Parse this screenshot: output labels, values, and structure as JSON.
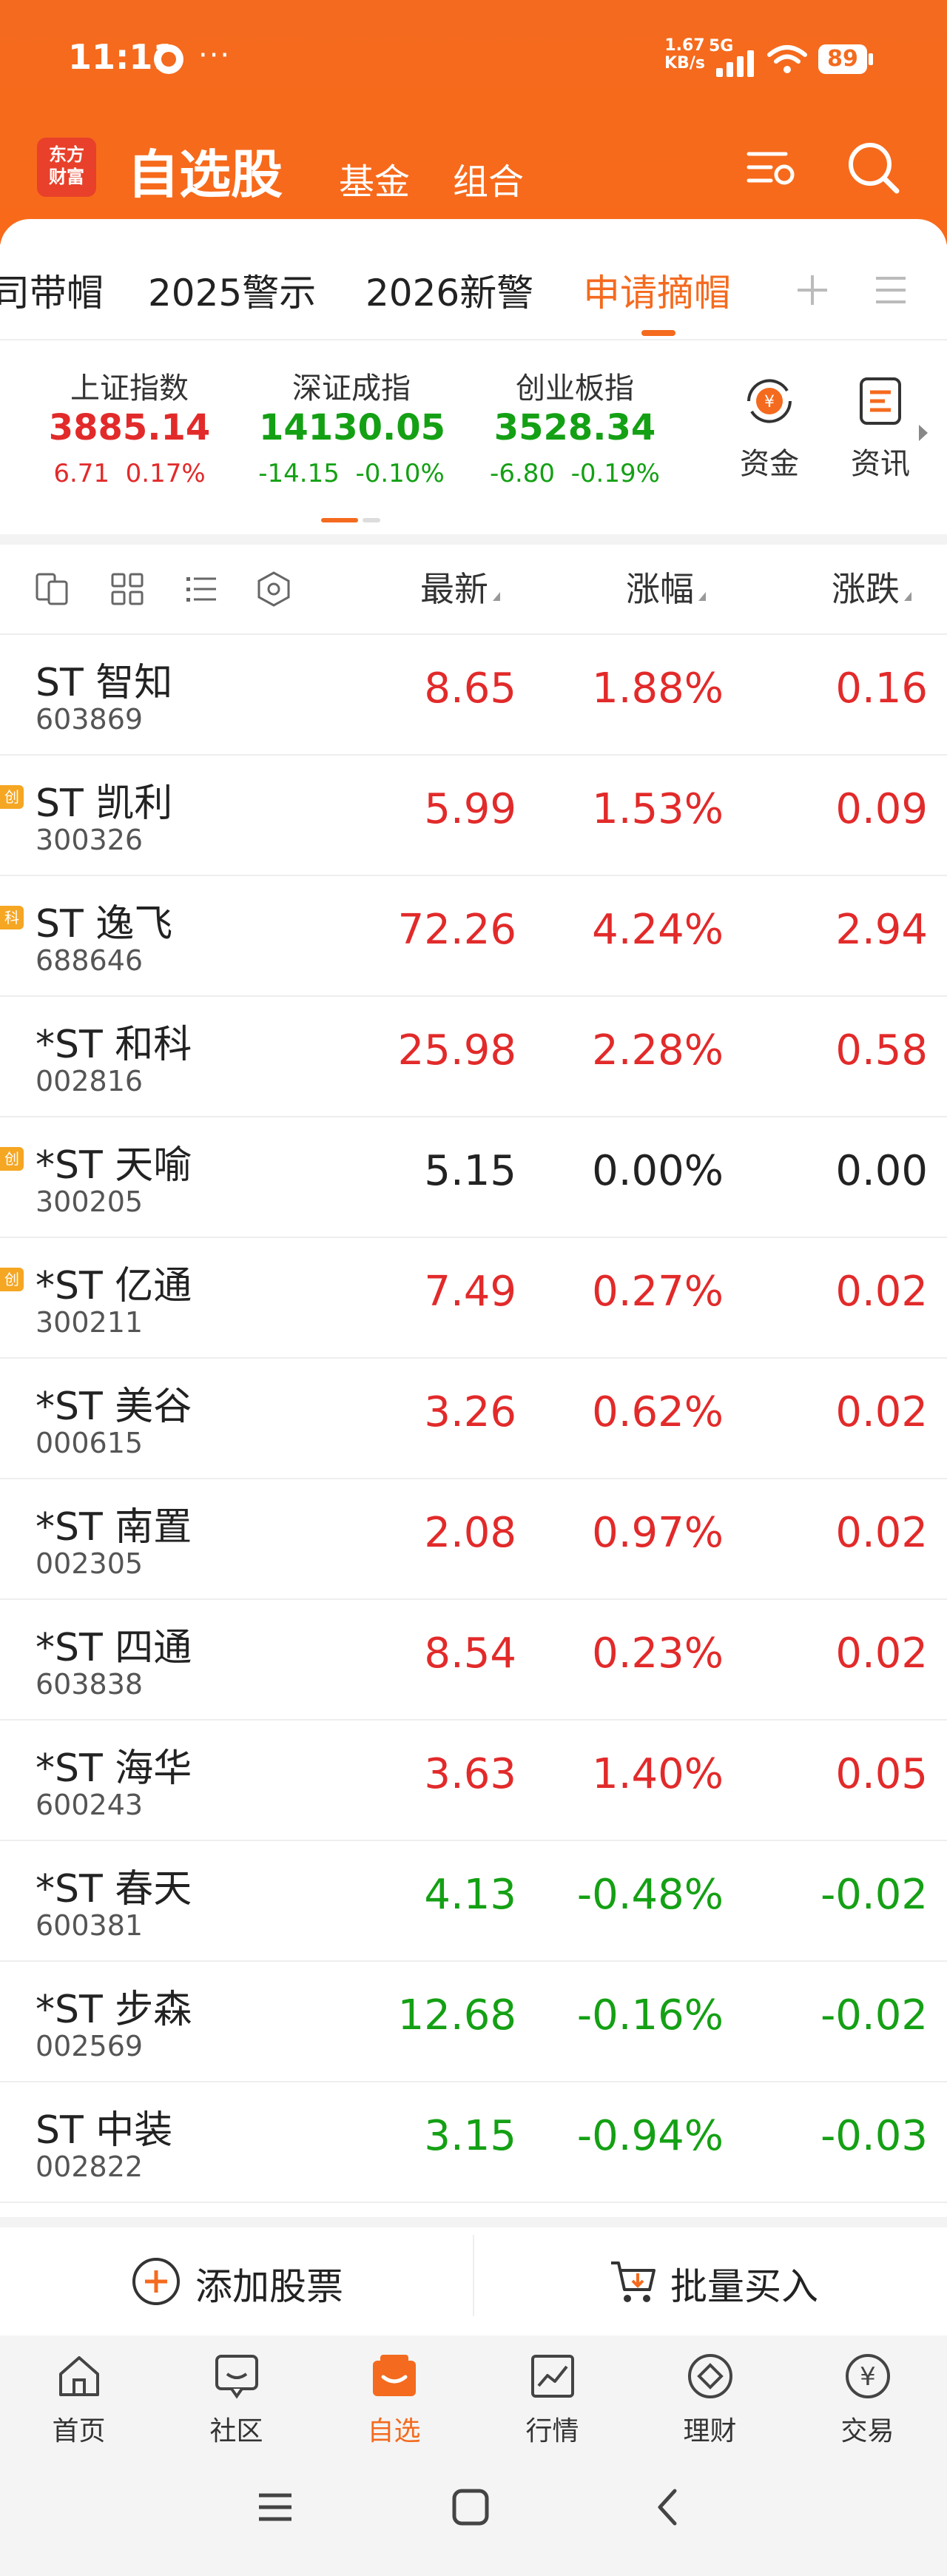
{
  "status_bar": {
    "time": "11:11",
    "more": "···",
    "net_speed_value": "1.67",
    "net_speed_unit": "KB/s",
    "network": "5G",
    "battery": "89"
  },
  "header": {
    "logo_line1": "东方",
    "logo_line2": "财富",
    "title": "自选股",
    "tabs": [
      "基金",
      "组合"
    ],
    "icons": [
      "settings-filter-icon",
      "search-icon"
    ]
  },
  "watchlist_tabs": {
    "items": [
      "司带帽",
      "2025警示",
      "2026新警",
      "申请摘帽"
    ],
    "active_index": 3
  },
  "indices": [
    {
      "name": "上证指数",
      "value": "3885.14",
      "change": "6.71",
      "pct": "0.17%",
      "direction": "up"
    },
    {
      "name": "深证成指",
      "value": "14130.05",
      "change": "-14.15",
      "pct": "-0.10%",
      "direction": "down"
    },
    {
      "name": "创业板指",
      "value": "3528.34",
      "change": "-6.80",
      "pct": "-0.19%",
      "direction": "down"
    }
  ],
  "side_buttons": [
    {
      "label": "资金",
      "icon": "yuan-flow-icon"
    },
    {
      "label": "资讯",
      "icon": "news-doc-icon"
    }
  ],
  "columns": {
    "price": "最新",
    "pct": "涨幅",
    "change": "涨跌"
  },
  "stocks": [
    {
      "name": "ST 智知",
      "code": "603869",
      "tag": "",
      "price": "8.65",
      "pct": "1.88%",
      "change": "0.16",
      "direction": "up"
    },
    {
      "name": "ST 凯利",
      "code": "300326",
      "tag": "创",
      "price": "5.99",
      "pct": "1.53%",
      "change": "0.09",
      "direction": "up"
    },
    {
      "name": "ST 逸飞",
      "code": "688646",
      "tag": "科",
      "price": "72.26",
      "pct": "4.24%",
      "change": "2.94",
      "direction": "up"
    },
    {
      "name": "*ST 和科",
      "code": "002816",
      "tag": "",
      "price": "25.98",
      "pct": "2.28%",
      "change": "0.58",
      "direction": "up"
    },
    {
      "name": "*ST 天喻",
      "code": "300205",
      "tag": "创",
      "price": "5.15",
      "pct": "0.00%",
      "change": "0.00",
      "direction": "flat"
    },
    {
      "name": "*ST 亿通",
      "code": "300211",
      "tag": "创",
      "price": "7.49",
      "pct": "0.27%",
      "change": "0.02",
      "direction": "up"
    },
    {
      "name": "*ST 美谷",
      "code": "000615",
      "tag": "",
      "price": "3.26",
      "pct": "0.62%",
      "change": "0.02",
      "direction": "up"
    },
    {
      "name": "*ST 南置",
      "code": "002305",
      "tag": "",
      "price": "2.08",
      "pct": "0.97%",
      "change": "0.02",
      "direction": "up"
    },
    {
      "name": "*ST 四通",
      "code": "603838",
      "tag": "",
      "price": "8.54",
      "pct": "0.23%",
      "change": "0.02",
      "direction": "up"
    },
    {
      "name": "*ST 海华",
      "code": "600243",
      "tag": "",
      "price": "3.63",
      "pct": "1.40%",
      "change": "0.05",
      "direction": "up"
    },
    {
      "name": "*ST 春天",
      "code": "600381",
      "tag": "",
      "price": "4.13",
      "pct": "-0.48%",
      "change": "-0.02",
      "direction": "down"
    },
    {
      "name": "*ST 步森",
      "code": "002569",
      "tag": "",
      "price": "12.68",
      "pct": "-0.16%",
      "change": "-0.02",
      "direction": "down"
    },
    {
      "name": "ST 中装",
      "code": "002822",
      "tag": "",
      "price": "3.15",
      "pct": "-0.94%",
      "change": "-0.03",
      "direction": "down"
    }
  ],
  "actions": {
    "add": "添加股票",
    "batch_buy": "批量买入"
  },
  "bottom_nav": {
    "items": [
      {
        "label": "首页",
        "icon": "home-icon"
      },
      {
        "label": "社区",
        "icon": "community-icon"
      },
      {
        "label": "自选",
        "icon": "watchlist-icon"
      },
      {
        "label": "行情",
        "icon": "market-chart-icon"
      },
      {
        "label": "理财",
        "icon": "wealth-icon"
      },
      {
        "label": "交易",
        "icon": "trade-yuan-icon"
      }
    ],
    "active_index": 2
  },
  "colors": {
    "brand_orange": "#f46a1e",
    "up_red": "#e22a2a",
    "down_green": "#14a014"
  }
}
